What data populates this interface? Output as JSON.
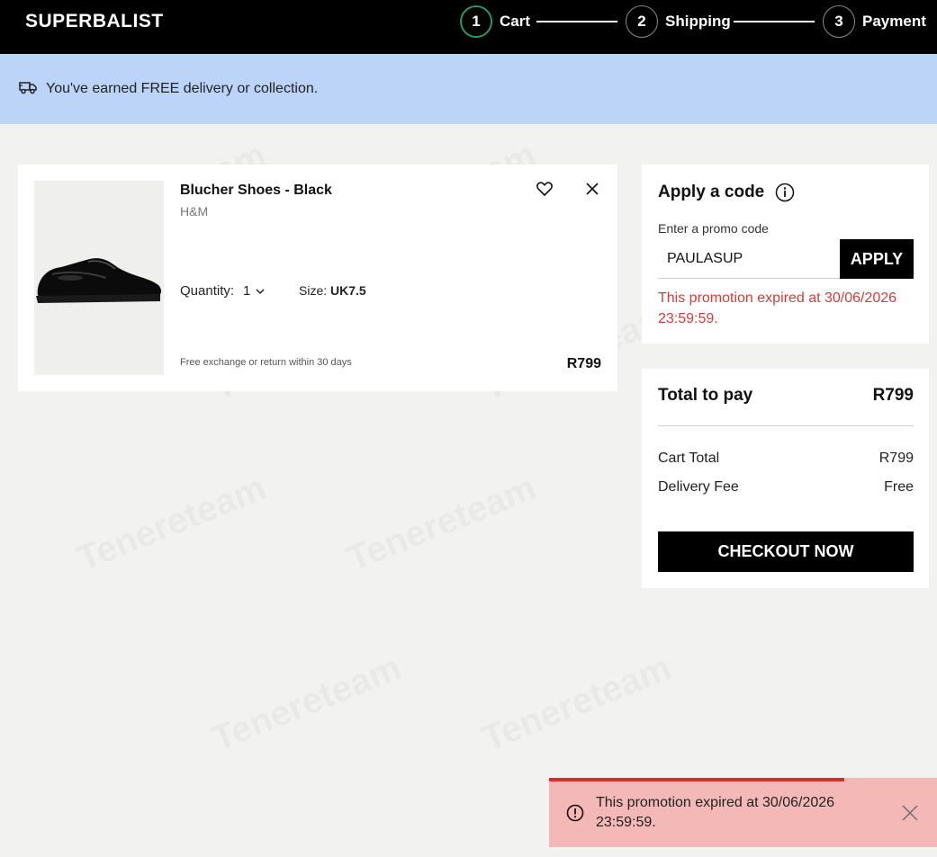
{
  "header": {
    "logo": "SUPERBALIST",
    "steps": [
      {
        "number": "1",
        "label": "Cart",
        "active": true
      },
      {
        "number": "2",
        "label": "Shipping",
        "active": false
      },
      {
        "number": "3",
        "label": "Payment",
        "active": false
      }
    ]
  },
  "banner": {
    "icon": "delivery-truck-icon",
    "text": "You've earned FREE delivery or collection."
  },
  "cart_item": {
    "title": "Blucher Shoes - Black",
    "brand": "H&M",
    "quantity_label": "Quantity:",
    "quantity_value": "1",
    "size_label": "Size:",
    "size_value": "UK7.5",
    "return_note": "Free exchange or return within 30 days",
    "price": "R799"
  },
  "promo": {
    "title": "Apply a code",
    "input_label": "Enter a promo code",
    "input_value": "PAULASUP",
    "apply_label": "APPLY",
    "error": "This promotion expired at 30/06/2026 23:59:59."
  },
  "totals": {
    "total_label": "Total to pay",
    "total_value": "R799",
    "cart_total_label": "Cart Total",
    "cart_total_value": "R799",
    "delivery_label": "Delivery Fee",
    "delivery_value": "Free",
    "checkout_label": "CHECKOUT NOW"
  },
  "toast": {
    "message": "This promotion expired at 30/06/2026 23:59:59.",
    "progress": 0.76
  },
  "watermark": "Tenereteam",
  "colors": {
    "header_bg": "#000000",
    "banner_bg": "#bcd4f8",
    "page_bg": "#f2f2f1",
    "active_step": "#1f9a6a",
    "error_text": "#d43c3c",
    "toast_bg": "#f4b9b6",
    "toast_progress": "#d62f2a"
  }
}
